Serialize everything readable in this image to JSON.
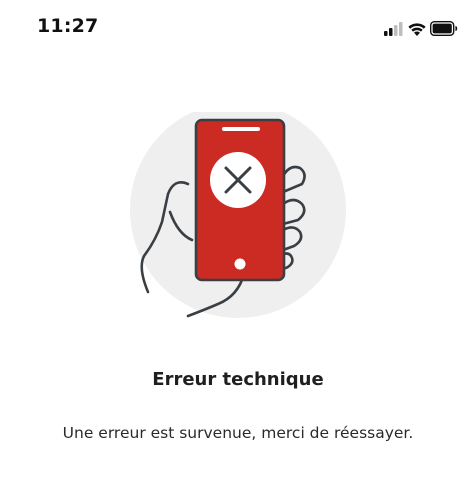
{
  "status_bar": {
    "time": "11:27",
    "icons": [
      "signal-icon",
      "wifi-icon",
      "battery-icon"
    ]
  },
  "illustration": {
    "icon": "phone-error-icon",
    "phone_color": "#cc2b24",
    "circle_color": "#efefef"
  },
  "error": {
    "title": "Erreur technique",
    "message": "Une erreur est survenue, merci de réessayer."
  }
}
